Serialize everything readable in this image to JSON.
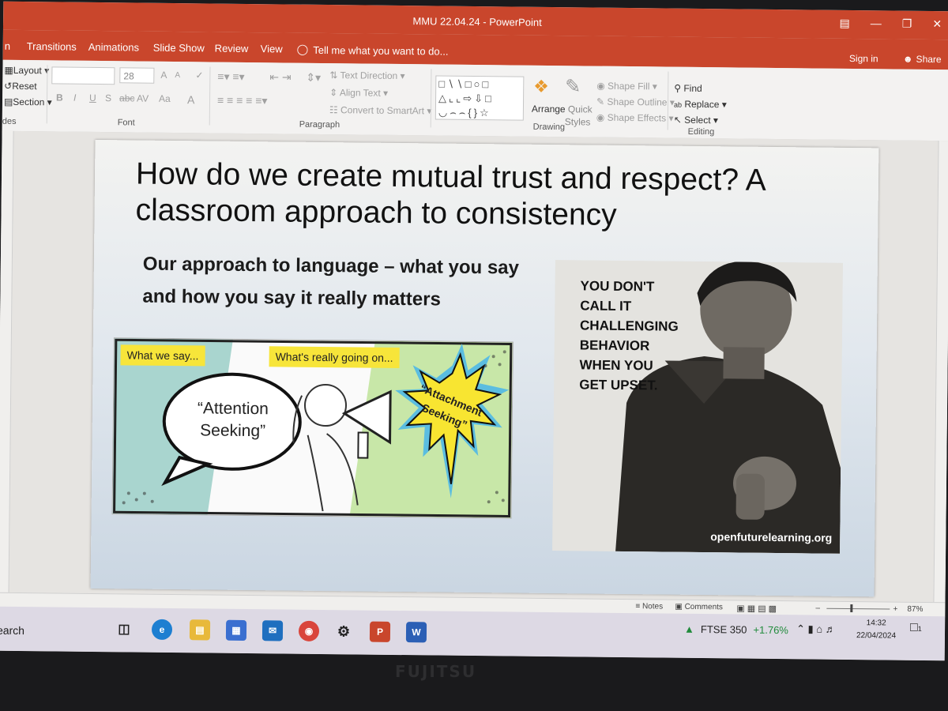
{
  "window": {
    "title": "MMU 22.04.24 - PowerPoint"
  },
  "tabs": [
    {
      "label": "n"
    },
    {
      "label": "Transitions"
    },
    {
      "label": "Animations"
    },
    {
      "label": "Slide Show"
    },
    {
      "label": "Review"
    },
    {
      "label": "View"
    }
  ],
  "tell_me": "Tell me what you want to do...",
  "account": {
    "sign_in": "Sign in",
    "share": "Share"
  },
  "ribbon": {
    "slides": {
      "layout": "Layout",
      "reset": "Reset",
      "section": "Section",
      "group_label": "des"
    },
    "font": {
      "size": "28",
      "bold": "B",
      "italic": "I",
      "underline": "U",
      "shadow": "S",
      "strike": "abc",
      "spacing": "AV",
      "case": "Aa",
      "color": "A",
      "grow": "A",
      "shrink": "A",
      "group_label": "Font"
    },
    "paragraph": {
      "text_direction": "Text Direction",
      "align_text": "Align Text",
      "convert_smartart": "Convert to SmartArt",
      "group_label": "Paragraph"
    },
    "drawing": {
      "arrange": "Arrange",
      "quick": "Quick",
      "styles": "Styles",
      "shape_fill": "Shape Fill",
      "shape_outline": "Shape Outline",
      "shape_effects": "Shape Effects",
      "group_label": "Drawing"
    },
    "editing": {
      "find": "Find",
      "replace": "Replace",
      "select": "Select",
      "group_label": "Editing"
    }
  },
  "slide": {
    "title": "How do we create mutual trust and respect? A classroom approach to consistency",
    "subtitle": "Our approach to language – what you say and how you say it really matters",
    "comic": {
      "tag_left": "What we say...",
      "tag_right": "What's really going on...",
      "bubble_line1": "“Attention",
      "bubble_line2": "Seeking”",
      "burst_line1": "“Attachment",
      "burst_line2": "Seeking”"
    },
    "poster": {
      "lines": [
        "YOU DON'T",
        "CALL IT",
        "CHALLENGING",
        "BEHAVIOR",
        "WHEN YOU",
        "GET UPSET."
      ],
      "credit": "openfuturelearning.org"
    }
  },
  "statusbar": {
    "notes": "Notes",
    "comments": "Comments",
    "zoom": "87%"
  },
  "taskbar": {
    "search": "earch",
    "ftse_label": "FTSE 350",
    "ftse_change": "+1.76%",
    "time": "14:32",
    "date": "22/04/2024",
    "notification_count": "1"
  },
  "bezel": {
    "brand": "FUJITSU"
  },
  "colors": {
    "accent": "#c9462c",
    "ftse_positive": "#1f8a3a",
    "comic_yellow": "#f7e53a"
  }
}
